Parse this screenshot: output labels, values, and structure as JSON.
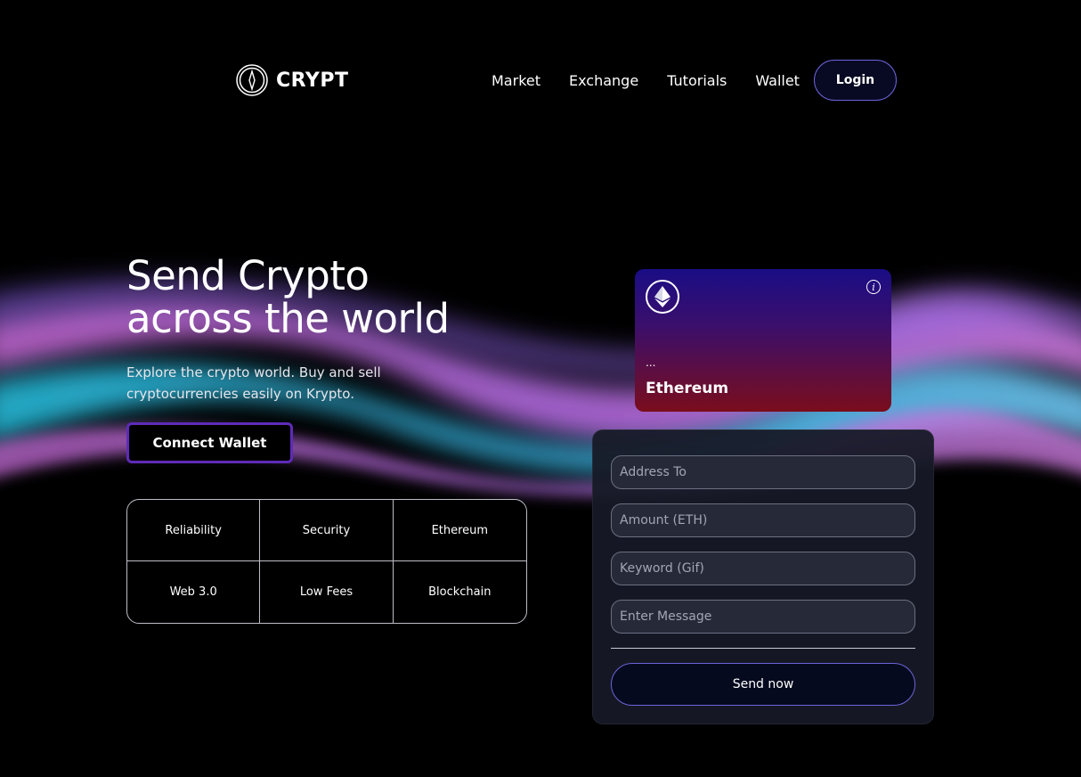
{
  "brand": {
    "name": "CRYPT",
    "logo_icon": "compass-logo-icon"
  },
  "nav": {
    "items": [
      {
        "label": "Market"
      },
      {
        "label": "Exchange"
      },
      {
        "label": "Tutorials"
      },
      {
        "label": "Wallet"
      }
    ],
    "login_label": "Login"
  },
  "hero": {
    "title_line1": "Send Crypto",
    "title_line2": "across the world",
    "subtitle": "Explore the crypto world. Buy and sell cryptocurrencies easily on Krypto.",
    "connect_label": "Connect Wallet"
  },
  "features": [
    {
      "label": "Reliability"
    },
    {
      "label": "Security"
    },
    {
      "label": "Ethereum"
    },
    {
      "label": "Web 3.0"
    },
    {
      "label": "Low Fees"
    },
    {
      "label": "Blockchain"
    }
  ],
  "eth_card": {
    "icon": "ethereum-icon",
    "info_icon": "info-icon",
    "address": "...",
    "name": "Ethereum"
  },
  "form": {
    "address_placeholder": "Address To",
    "amount_placeholder": "Amount (ETH)",
    "keyword_placeholder": "Keyword (Gif)",
    "message_placeholder": "Enter Message",
    "send_label": "Send now"
  },
  "colors": {
    "background": "#000000",
    "accent_border": "#6c63d8",
    "connect_border": "#5e2bb8",
    "card_top": "#1a0d86",
    "card_bottom": "#7a0d1c",
    "panel": "#161926"
  }
}
